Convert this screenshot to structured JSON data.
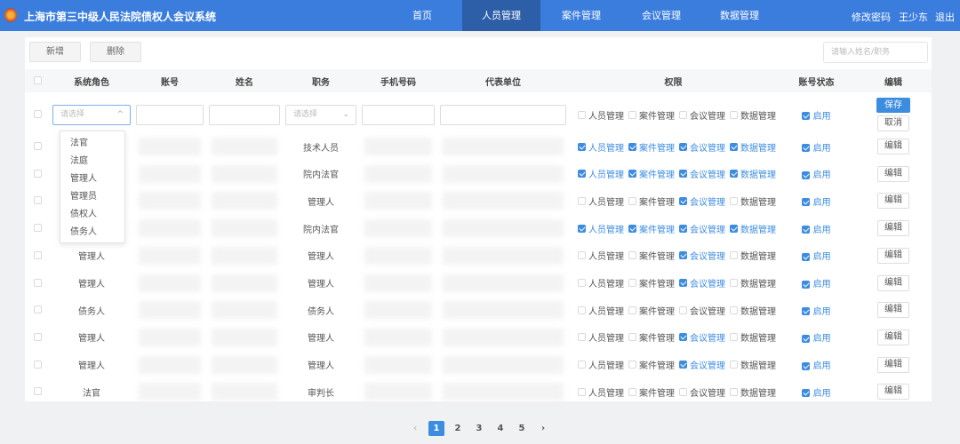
{
  "header": {
    "title": "上海市第三中级人民法院债权人会议系统",
    "nav": [
      "首页",
      "人员管理",
      "案件管理",
      "会议管理",
      "数据管理"
    ],
    "active_nav": 1,
    "change_password": "修改密码",
    "user": "王少东",
    "logout": "退出"
  },
  "toolbar": {
    "add": "新增",
    "delete": "删除",
    "search_placeholder": "请输入姓名/职务"
  },
  "columns": [
    "系统角色",
    "账号",
    "姓名",
    "职务",
    "手机号码",
    "代表单位",
    "权限",
    "账号状态",
    "编辑"
  ],
  "perm_labels": [
    "人员管理",
    "案件管理",
    "会议管理",
    "数据管理"
  ],
  "edit_row": {
    "role_placeholder": "请选择",
    "position_placeholder": "请选择",
    "perms": [
      false,
      false,
      false,
      false
    ],
    "status": true,
    "status_label": "启用",
    "save": "保存",
    "cancel": "取消"
  },
  "role_dropdown": [
    "法官",
    "法庭",
    "管理人",
    "管理员",
    "债权人",
    "债务人"
  ],
  "rows": [
    {
      "role": "",
      "position": "技术人员",
      "perms": [
        true,
        true,
        true,
        true
      ],
      "status": true
    },
    {
      "role": "",
      "position": "院内法官",
      "perms": [
        true,
        true,
        true,
        true
      ],
      "status": true
    },
    {
      "role": "",
      "position": "管理人",
      "perms": [
        false,
        false,
        true,
        false
      ],
      "status": true
    },
    {
      "role": "",
      "position": "院内法官",
      "perms": [
        true,
        true,
        true,
        true
      ],
      "status": true
    },
    {
      "role": "管理人",
      "position": "管理人",
      "perms": [
        false,
        false,
        true,
        false
      ],
      "status": true
    },
    {
      "role": "管理人",
      "position": "管理人",
      "perms": [
        false,
        false,
        true,
        false
      ],
      "status": true
    },
    {
      "role": "债务人",
      "position": "债务人",
      "perms": [
        false,
        false,
        false,
        false
      ],
      "status": true
    },
    {
      "role": "管理人",
      "position": "管理人",
      "perms": [
        false,
        false,
        true,
        false
      ],
      "status": true
    },
    {
      "role": "管理人",
      "position": "管理人",
      "perms": [
        false,
        false,
        true,
        false
      ],
      "status": true
    },
    {
      "role": "法官",
      "position": "审判长",
      "perms": [
        false,
        false,
        false,
        false
      ],
      "status": true
    }
  ],
  "row_status_label": "启用",
  "row_edit": "编辑",
  "pagination": {
    "pages": [
      "1",
      "2",
      "3",
      "4",
      "5"
    ],
    "current": "1",
    "prev": "‹",
    "next": "›"
  },
  "colors": {
    "brand": "#3b7ddd",
    "active_nav": "#2d5ea8",
    "accent": "#3c8ce0"
  }
}
